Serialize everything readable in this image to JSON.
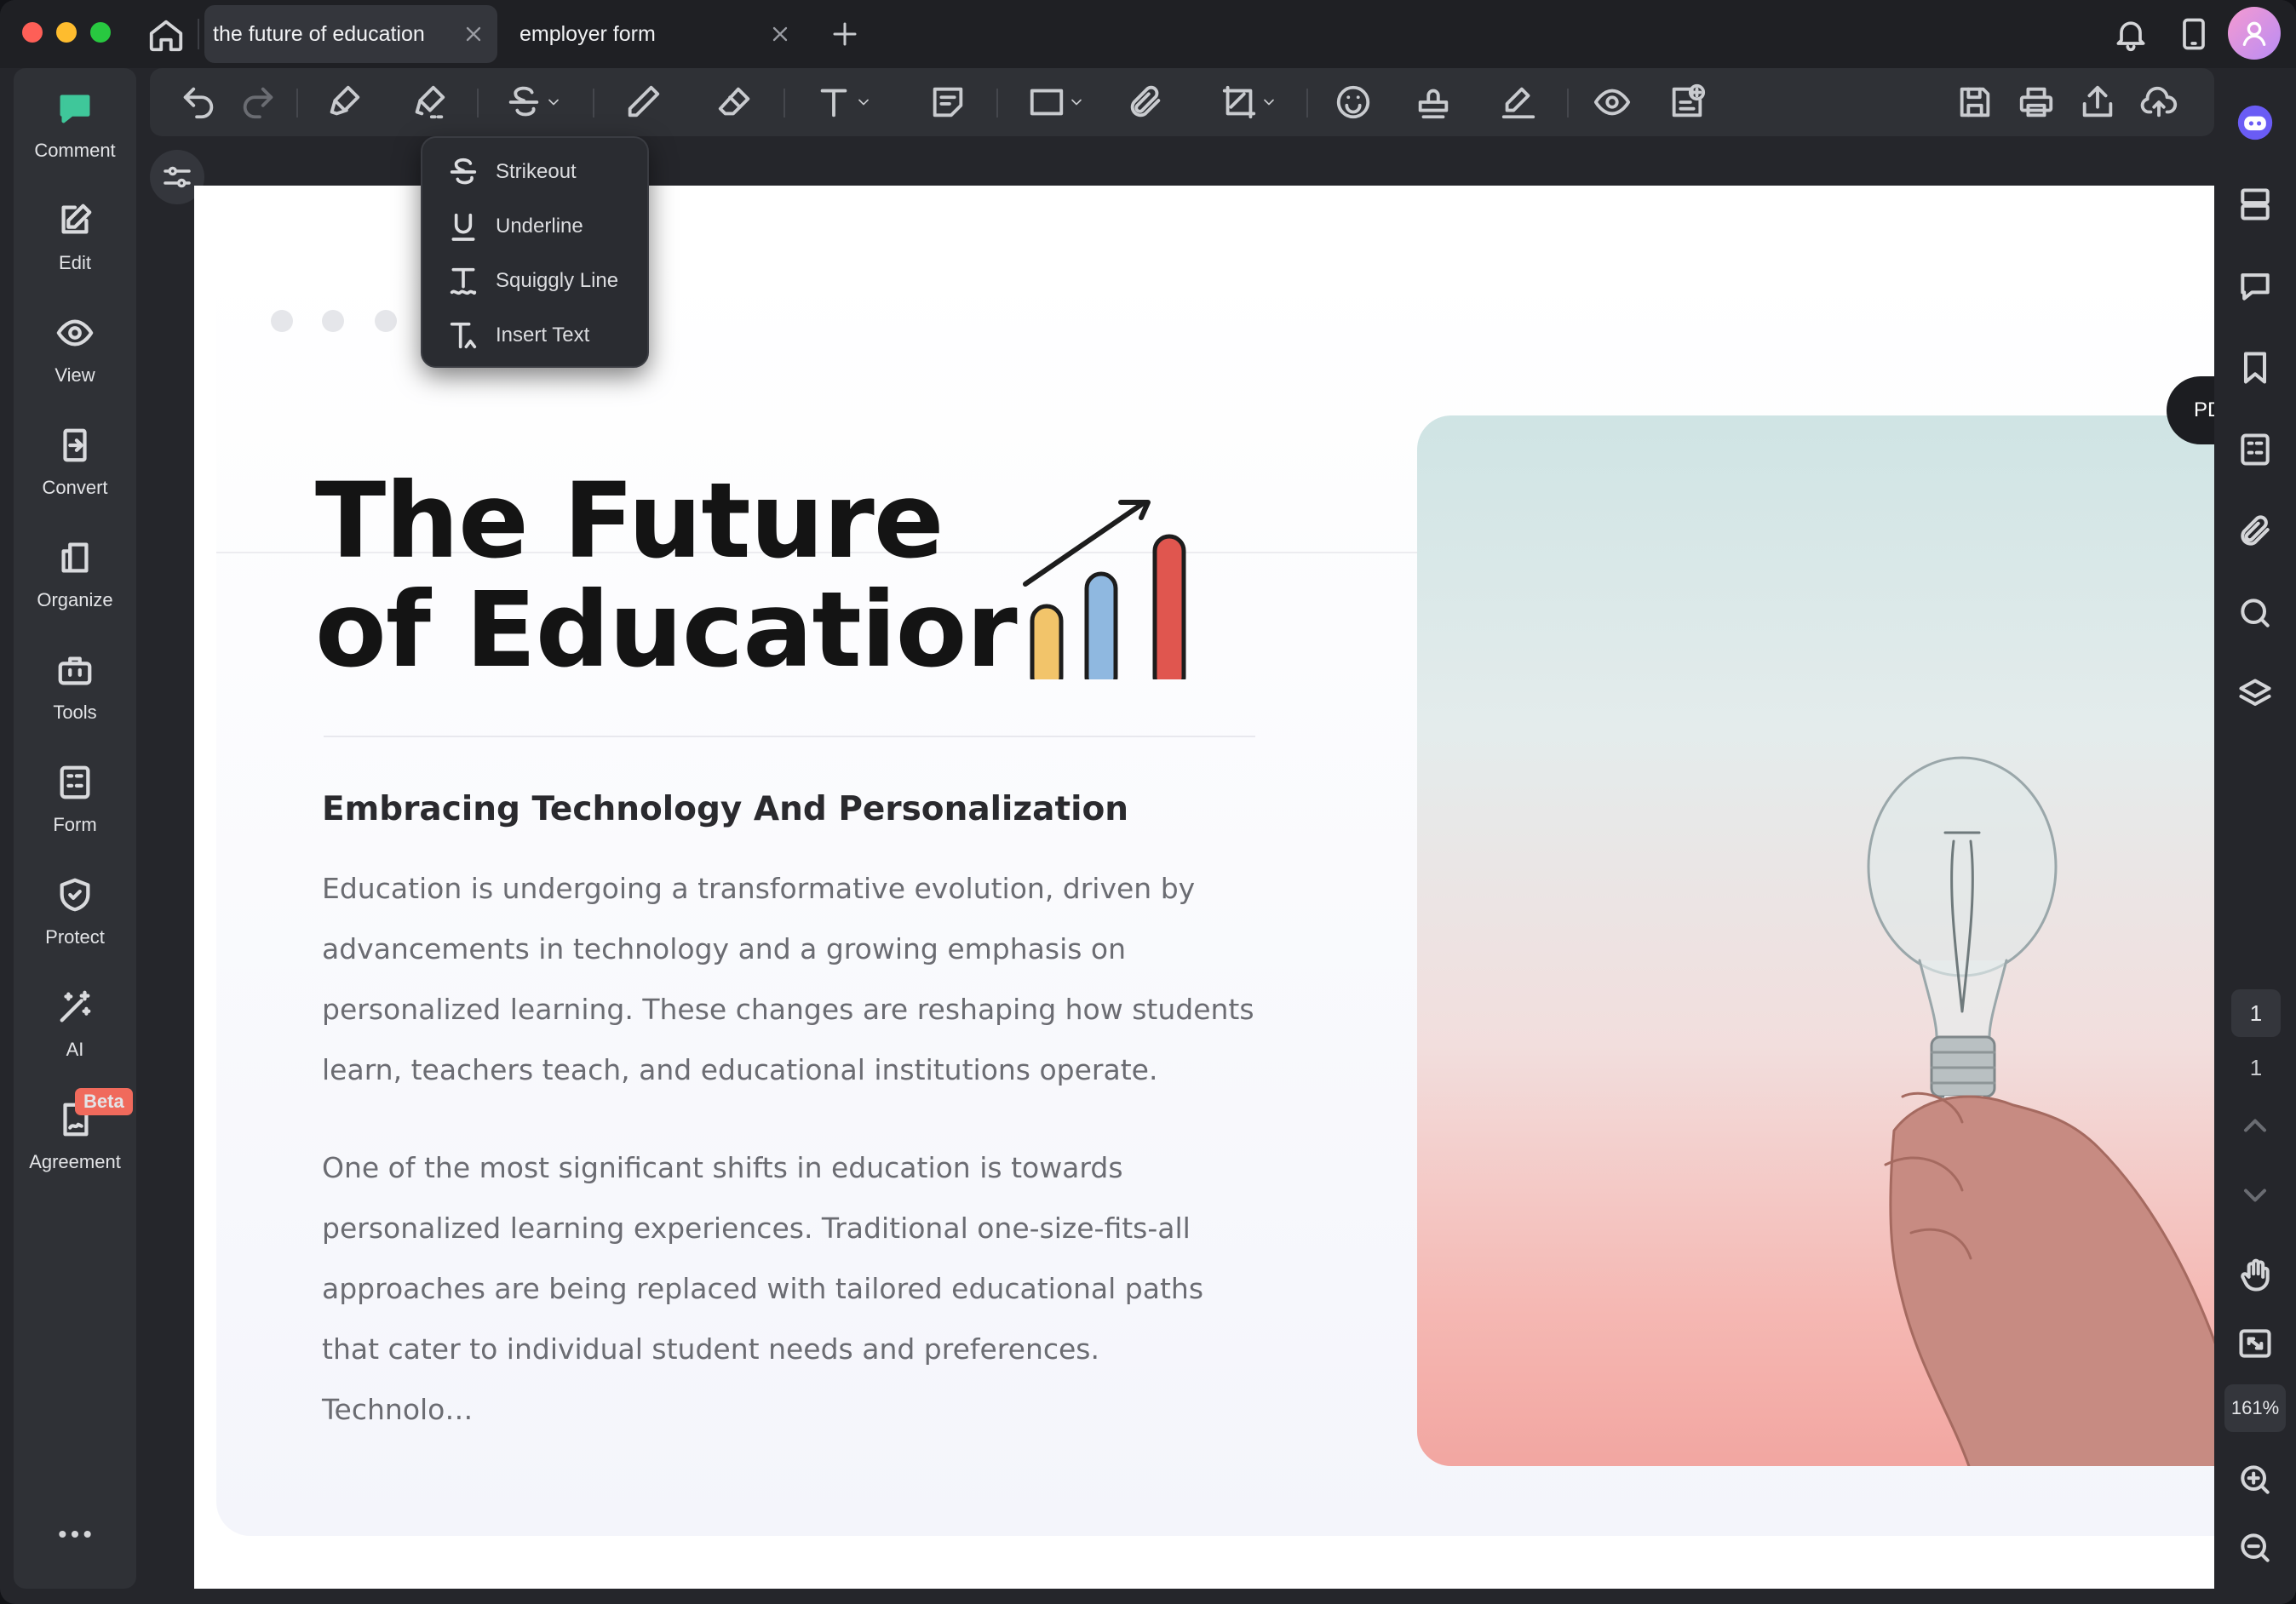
{
  "tabs": [
    {
      "label": "the future of education",
      "active": true
    },
    {
      "label": "employer form",
      "active": false
    }
  ],
  "icons": {
    "home": "home-icon",
    "new_tab": "plus-icon",
    "notifications": "bell-icon",
    "device": "tablet-icon",
    "avatar": "user-avatar"
  },
  "sidebar": {
    "items": [
      {
        "label": "Comment",
        "icon": "comment-icon",
        "active": true
      },
      {
        "label": "Edit",
        "icon": "edit-icon"
      },
      {
        "label": "View",
        "icon": "eye-icon"
      },
      {
        "label": "Convert",
        "icon": "convert-icon"
      },
      {
        "label": "Organize",
        "icon": "organize-icon"
      },
      {
        "label": "Tools",
        "icon": "toolbox-icon"
      },
      {
        "label": "Form",
        "icon": "form-icon"
      },
      {
        "label": "Protect",
        "icon": "shield-icon"
      },
      {
        "label": "AI",
        "icon": "magic-wand-icon"
      },
      {
        "label": "Agreement",
        "icon": "agreement-icon",
        "badge": "Beta"
      }
    ],
    "more": "more-icon"
  },
  "toolbar": {
    "tools": [
      "undo",
      "redo",
      "highlight",
      "area-highlight",
      "strikethrough",
      "pencil",
      "eraser",
      "text",
      "sticky-note",
      "shape",
      "attachment",
      "crop",
      "sticker",
      "stamp",
      "signature",
      "hide-annotations",
      "add-comment",
      "save",
      "print",
      "share",
      "upload"
    ]
  },
  "strikeout_menu": {
    "items": [
      {
        "label": "Strikeout",
        "icon": "strikeout-icon"
      },
      {
        "label": "Underline",
        "icon": "underline-icon"
      },
      {
        "label": "Squiggly Line",
        "icon": "squiggly-icon"
      },
      {
        "label": "Insert Text",
        "icon": "insert-text-icon"
      }
    ]
  },
  "document": {
    "pdf_to_word_label": "PDF To Word",
    "title_line1": "The Future",
    "title_line2": "of Educatior",
    "subheading": "Embracing Technology And Personalization",
    "para1": [
      "Education is undergoing a transformative evolution, driven by",
      "advancements in technology and a growing emphasis on",
      "personalized learning. These changes are reshaping how students",
      "learn, teachers teach, and educational institutions operate."
    ],
    "para2": [
      "One of the most significant shifts in education is towards",
      "personalized learning experiences. Traditional one-size-fits-all",
      "approaches are being replaced with tailored educational paths",
      "that cater to individual student needs and preferences. Technolo…"
    ],
    "chart_bar_colors": [
      "#f2c46a",
      "#8fb8e0",
      "#e0564f"
    ]
  },
  "right_panel": {
    "current_page": "1",
    "total_pages": "1",
    "zoom": "161%"
  }
}
